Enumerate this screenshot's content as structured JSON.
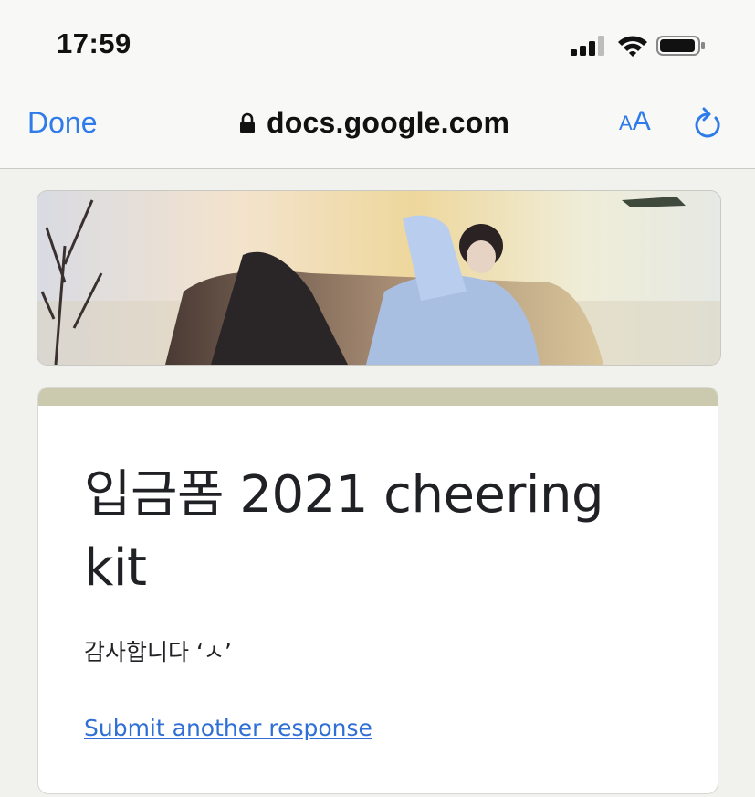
{
  "status_bar": {
    "time": "17:59",
    "icons": [
      "cellular-signal-icon",
      "wifi-icon",
      "battery-icon"
    ]
  },
  "browser": {
    "done_label": "Done",
    "url": "docs.google.com",
    "secure_icon": "lock-icon",
    "text_size_small": "A",
    "text_size_large": "A",
    "reload_icon": "reload-icon",
    "accent_color": "#2f7bea"
  },
  "form": {
    "header_image": "banner-photo",
    "accent_color": "#cbc9ae",
    "title": "입금폼 2021 cheering kit",
    "confirmation_message": "감사합니다 ‘ㅅ’",
    "submit_another_label": "Submit another response",
    "link_color": "#2f6fd6"
  }
}
